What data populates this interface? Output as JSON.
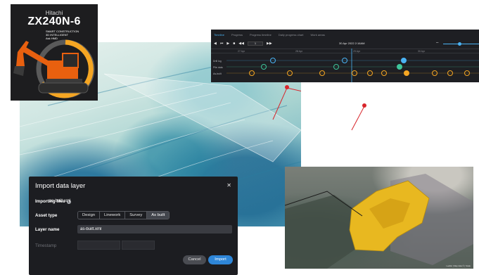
{
  "machine": {
    "brand": "Hitachi",
    "model": "ZX240N-6",
    "badge_line1": "SMART CONSTRUCTION",
    "badge_line2": "3D INTELLIGENT",
    "badge_line3": "Ask HMD",
    "ring_color": "#f5a623",
    "body_color": "#e8600f"
  },
  "timeline": {
    "tabs": [
      {
        "label": "Timeline"
      },
      {
        "label": "Progress"
      },
      {
        "label": "Progress timeline"
      },
      {
        "label": "Daily progress chart"
      },
      {
        "label": "Work areas"
      }
    ],
    "speed": "1",
    "date": "30 Apr 2022 2:16AM",
    "ticks": [
      "27 Apr",
      "28 Apr",
      "29 Apr",
      "30 Apr"
    ],
    "rows": [
      {
        "label": "Drill log",
        "color": "#4ab3f4"
      },
      {
        "label": "Pile data",
        "color": "#3ec59a"
      },
      {
        "label": "As-built",
        "color": "#f5a623"
      }
    ],
    "accent": "#4ab3f4"
  },
  "dialog": {
    "title": "Import data layer",
    "importing_label": "Importing files",
    "file_name": "as-built.xml",
    "asset_type_label": "Asset type",
    "asset_types": [
      {
        "label": "Design"
      },
      {
        "label": "Linework"
      },
      {
        "label": "Survey"
      },
      {
        "label": "As built"
      }
    ],
    "selected_asset_type": "As built",
    "layer_name_label": "Layer name",
    "layer_name_value": "as-built.xml",
    "timestamp_label": "Timestamp",
    "cancel_label": "Cancel",
    "import_label": "Import",
    "accent": "#2e86d8"
  },
  "view3d": {
    "surface_color": "#e8b820",
    "status_text": "Leaflet | Map data © | Scale"
  }
}
